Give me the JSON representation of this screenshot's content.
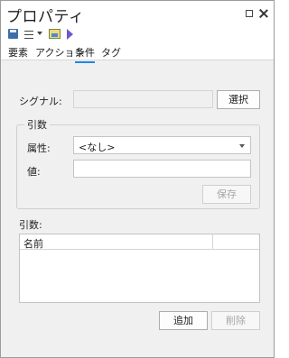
{
  "window": {
    "title": "プロパティ"
  },
  "toolbar": {
    "icons": [
      "save-icon",
      "menu-icon",
      "dropdown-caret-icon",
      "image-icon",
      "run-icon"
    ]
  },
  "tabs": [
    {
      "label": "要素"
    },
    {
      "label": "アクション"
    },
    {
      "label": "条件",
      "active": true
    },
    {
      "label": "タグ"
    }
  ],
  "signal": {
    "label": "シグナル:",
    "value": "",
    "select_button": "選択"
  },
  "argument_group": {
    "title": "引数",
    "attribute_label": "属性:",
    "attribute_value": "<なし>",
    "value_label": "値:",
    "value": "",
    "save_button": "保存"
  },
  "arguments": {
    "label": "引数:",
    "columns": [
      "名前",
      ""
    ],
    "rows": []
  },
  "buttons": {
    "add": "追加",
    "delete": "削除"
  },
  "colors": {
    "accent": "#1e88e5",
    "background": "#f0f0f0"
  }
}
